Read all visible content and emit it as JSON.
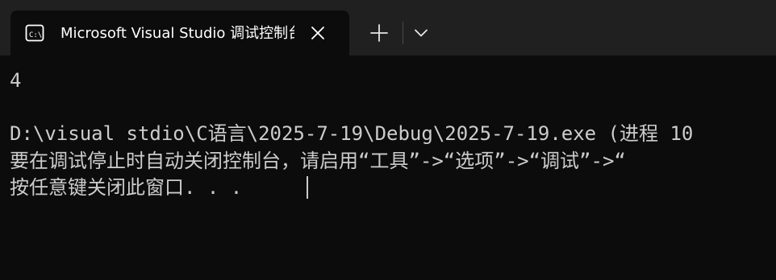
{
  "tab": {
    "title": "Microsoft Visual Studio 调试控制台",
    "icon": "console-icon",
    "close_icon": "close-icon"
  },
  "toolbar": {
    "new_tab_icon": "plus-icon",
    "dropdown_icon": "chevron-down-icon"
  },
  "console": {
    "lines": [
      "4",
      "",
      "D:\\visual stdio\\C语言\\2025-7-19\\Debug\\2025-7-19.exe (进程 10",
      "要在调试停止时自动关闭控制台，请启用“工具”->“选项”->“调试”->“",
      "按任意键关闭此窗口. . ."
    ]
  },
  "colors": {
    "titlebar": "#202020",
    "background": "#0c0c0c",
    "text": "#cccccc",
    "title_text": "#ffffff"
  }
}
